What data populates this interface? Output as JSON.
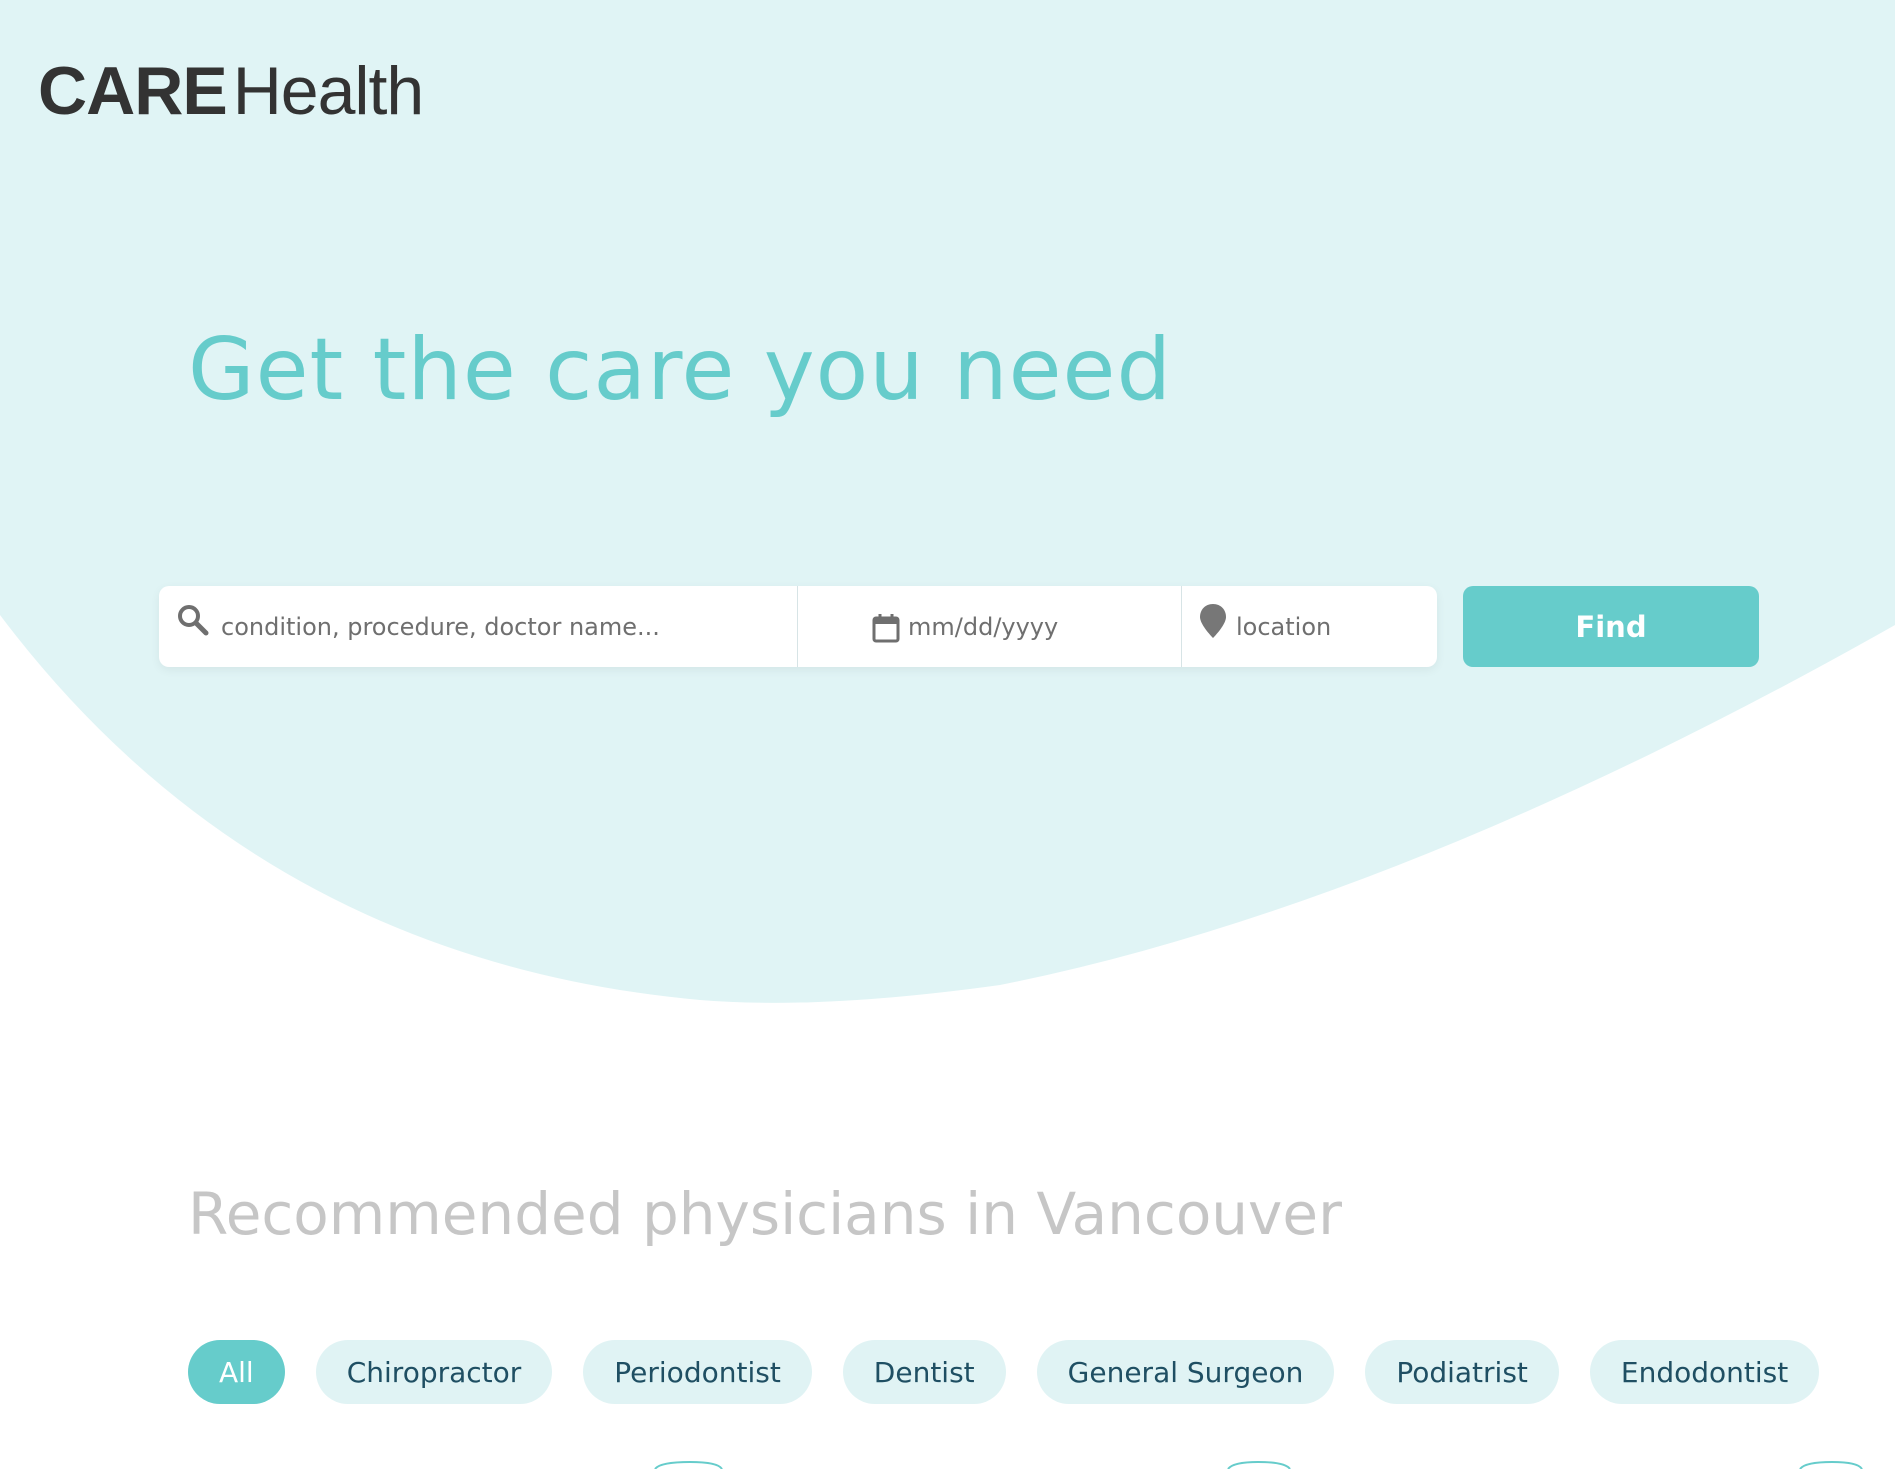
{
  "brand": {
    "care": "CARE",
    "health": "Health"
  },
  "hero": {
    "title": "Get the care you need"
  },
  "search": {
    "query_placeholder": "condition, procedure, doctor name...",
    "date_placeholder": "mm/dd/yyyy",
    "location_placeholder": "location",
    "find_label": "Find"
  },
  "recommended": {
    "title": "Recommended physicians in Vancouver",
    "filters": [
      {
        "label": "All",
        "active": true
      },
      {
        "label": "Chiropractor",
        "active": false
      },
      {
        "label": "Periodontist",
        "active": false
      },
      {
        "label": "Dentist",
        "active": false
      },
      {
        "label": "General Surgeon",
        "active": false
      },
      {
        "label": "Podiatrist",
        "active": false
      },
      {
        "label": "Endodontist",
        "active": false
      }
    ]
  },
  "colors": {
    "accent": "#66cccb",
    "hero_background": "#e0f4f5",
    "chip_background": "#e0f3f4",
    "chip_text": "#1f4f63",
    "logo_text": "#333333",
    "section_title": "#c6c6c6"
  },
  "icons": {
    "search": "search-icon",
    "date": "calendar-icon",
    "location": "map-pin-icon"
  }
}
